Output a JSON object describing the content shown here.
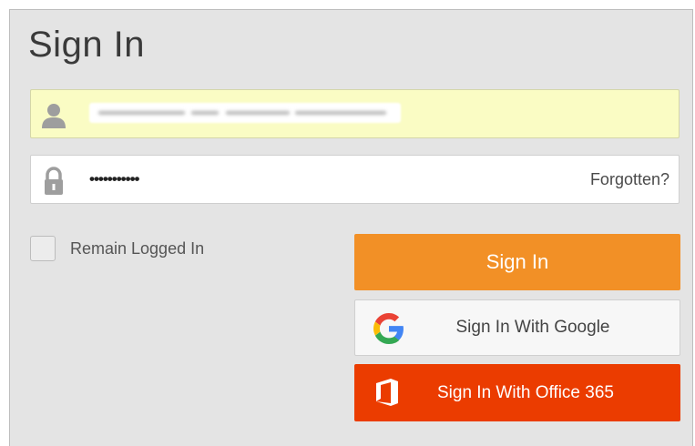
{
  "form": {
    "title": "Sign In",
    "username": {
      "icon": "user-icon",
      "value_obscured": true
    },
    "password": {
      "icon": "lock-icon",
      "masked_value": "•••••••••••",
      "forgot_label": "Forgotten?"
    },
    "remember": {
      "label": "Remain Logged In",
      "checked": false
    },
    "buttons": {
      "sign_in": "Sign In",
      "google": "Sign In With Google",
      "office": "Sign In With Office 365"
    }
  },
  "colors": {
    "panel_bg": "#e4e4e4",
    "username_bg": "#fafcc4",
    "sign_in_orange": "#f29026",
    "office_red": "#eb3c00"
  }
}
